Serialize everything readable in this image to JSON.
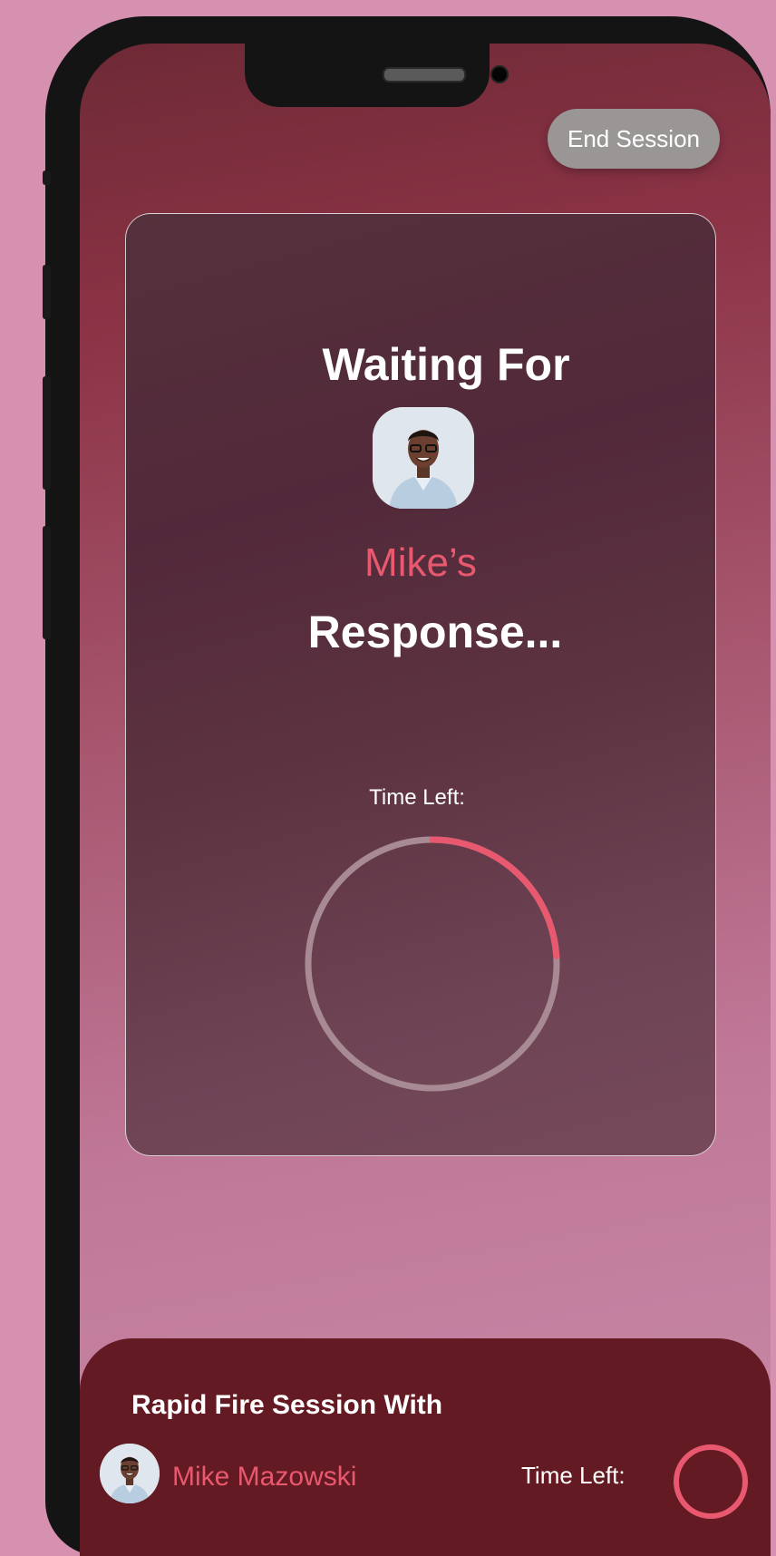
{
  "header": {
    "end_session_label": "End Session"
  },
  "card": {
    "title_top": "Waiting For",
    "participant_name": "Mike’s",
    "title_bottom": "Response...",
    "time_left_label": "Time Left:",
    "timer_progress": 0.24
  },
  "footer": {
    "session_title": "Rapid Fire Session With",
    "participant_full_name": "Mike Mazowski",
    "time_left_label": "Time Left:"
  },
  "colors": {
    "accent": "#e8596f",
    "timer_track": "#a88a94",
    "footer_bg": "#641a22"
  }
}
